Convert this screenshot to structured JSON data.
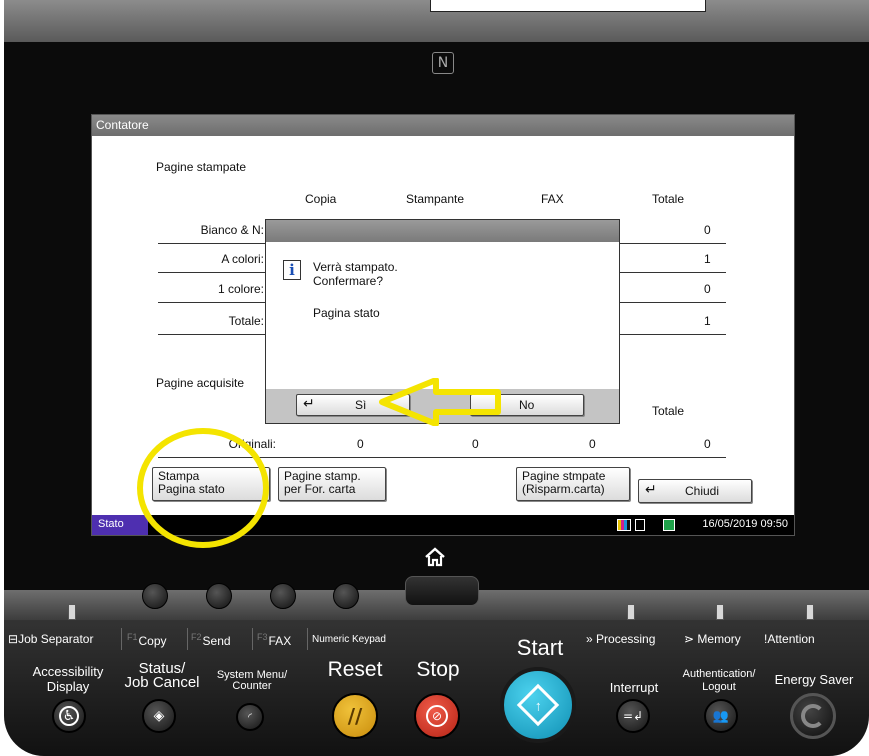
{
  "screen": {
    "title": "Contatore",
    "printed_section": "Pagine stampate",
    "scanned_section": "Pagine acquisite",
    "columns": [
      "Copia",
      "Stampante",
      "FAX",
      "Totale"
    ],
    "printed_rows": [
      {
        "label": "Bianco & N:",
        "total": "0"
      },
      {
        "label": "A colori:",
        "total": "1"
      },
      {
        "label": "1 colore:",
        "total": "0"
      },
      {
        "label": "Totale:",
        "total": "1"
      }
    ],
    "scanned_total_header": "Totale",
    "originals_row": {
      "label": "Originali:",
      "values": [
        "0",
        "0",
        "0",
        "0"
      ]
    },
    "buttons": {
      "print_status": "Stampa\nPagina stato",
      "pages_by_paper": "Pagine stamp.\nper For. carta",
      "pages_saving": "Pagine stmpate\n(Risparm.carta)",
      "close": "Chiudi"
    },
    "status_tab": "Stato",
    "datetime": "16/05/2019  09:50"
  },
  "dialog": {
    "message_line1": "Verrà stampato.",
    "message_line2": "Confermare?",
    "detail": "Pagina stato",
    "yes_label": "Sì",
    "no_label": "No"
  },
  "panel": {
    "job_separator": "Job Separator",
    "copy": {
      "fkey": "F1",
      "label": "Copy"
    },
    "send": {
      "fkey": "F2",
      "label": "Send"
    },
    "fax": {
      "fkey": "F3",
      "label": "FAX"
    },
    "numeric_keypad": "Numeric Keypad",
    "processing": "Processing",
    "memory": "Memory",
    "attention": "Attention",
    "accessibility": "Accessibility\nDisplay",
    "status_job_cancel": "Status/\nJob Cancel",
    "system_menu": "System Menu/\nCounter",
    "reset": "Reset",
    "stop": "Stop",
    "start": "Start",
    "interrupt": "Interrupt",
    "auth_logout": "Authentication/\nLogout",
    "energy_saver": "Energy Saver"
  },
  "colors": {
    "annotation_yellow": "#f4e400",
    "stato_tab": "#4e2fb0",
    "start_button": "#19b5d8",
    "stop_button": "#d83a2a",
    "reset_button": "#d9a21a"
  }
}
